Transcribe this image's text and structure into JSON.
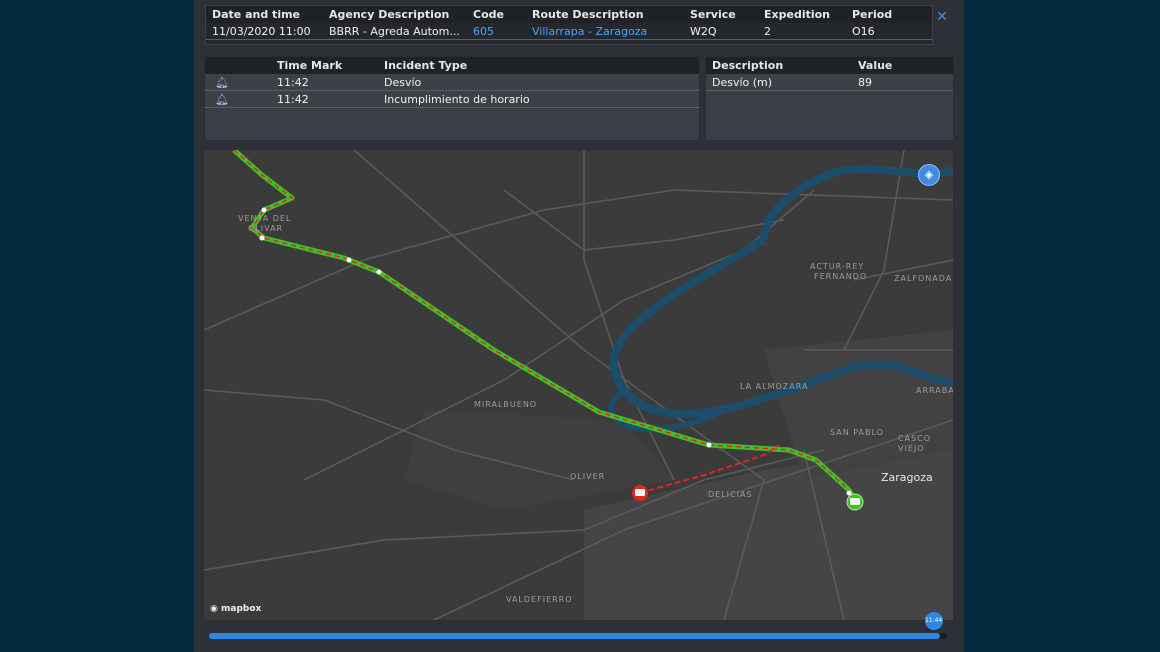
{
  "header": {
    "columns": [
      "Date and time",
      "Agency Description",
      "Code",
      "Route Description",
      "Service",
      "Expedition",
      "Period"
    ],
    "row": {
      "datetime": "11/03/2020 11:00",
      "agency": "BBRR - Agreda Autom...",
      "code": "605",
      "route": "Villarrapa - Zaragoza",
      "service": "W2Q",
      "expedition": "2",
      "period": "O16"
    }
  },
  "close_icon": "close-icon",
  "incidents": {
    "columns": [
      "Time Mark",
      "Incident Type"
    ],
    "rows": [
      {
        "icon": "bell-icon",
        "time": "11:42",
        "type": "Desvío"
      },
      {
        "icon": "bell-icon",
        "time": "11:42",
        "type": "Incumplimiento de horario"
      }
    ]
  },
  "values": {
    "columns": [
      "Description",
      "Value"
    ],
    "rows": [
      {
        "description": "Desvío (m)",
        "value": "89"
      }
    ]
  },
  "map": {
    "labels": {
      "venta": "VENTA DEL",
      "olivar": "OLIVAR",
      "actur": "ACTUR-REY",
      "fernando": "FERNANDO",
      "zalfonada": "ZALFONADA",
      "almozara": "LA ALMOZARA",
      "arrabal": "ARRABAL",
      "sanpablo": "SAN PABLO",
      "casco1": "CASCO",
      "casco2": "VIEJO",
      "miralbueno": "MIRALBUENO",
      "oliver": "OLIVER",
      "delicias": "DELICIAS",
      "valdefierro": "VALDEFIERRO",
      "city": "Zaragoza"
    },
    "attribution": "mapbox",
    "layers_icon": "layers-icon",
    "route_color": "#3fbf2a",
    "deviation_color": "#e0261f"
  },
  "timeline": {
    "progress": 0.99,
    "time_label": "11:44"
  }
}
